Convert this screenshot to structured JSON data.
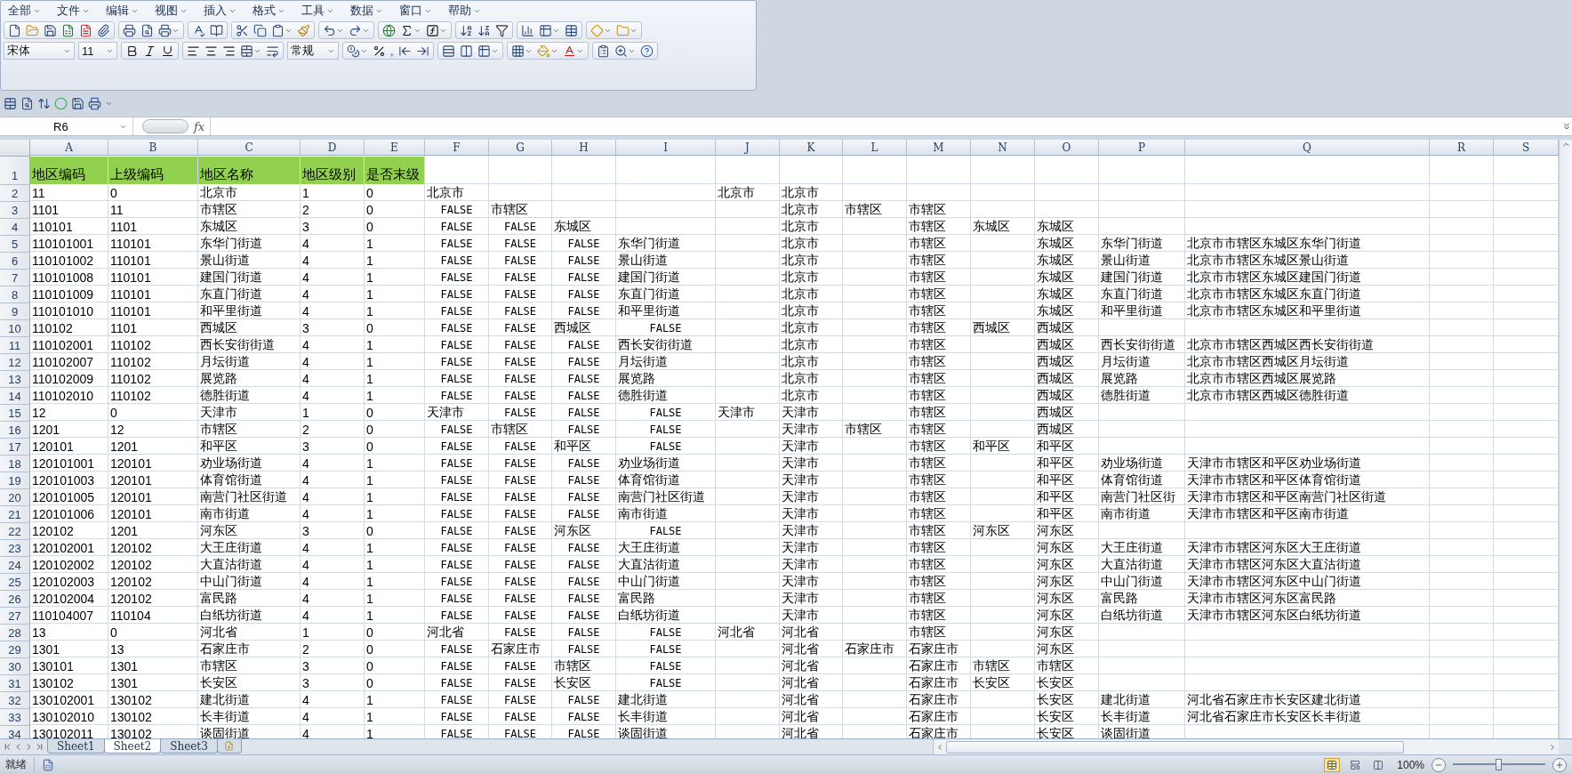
{
  "menu": [
    {
      "label": "全部"
    },
    {
      "label": "文件"
    },
    {
      "label": "编辑"
    },
    {
      "label": "视图"
    },
    {
      "label": "插入"
    },
    {
      "label": "格式"
    },
    {
      "label": "工具"
    },
    {
      "label": "数据"
    },
    {
      "label": "窗口"
    },
    {
      "label": "帮助"
    }
  ],
  "format_toolbar": {
    "font": "宋体",
    "font_size": "11",
    "number_format": "常规",
    "comma": ","
  },
  "formula_bar": {
    "name_box": "R6",
    "fx": "fx"
  },
  "columns": [
    "A",
    "B",
    "C",
    "D",
    "E",
    "F",
    "G",
    "H",
    "I",
    "J",
    "K",
    "L",
    "M",
    "N",
    "O",
    "P",
    "Q",
    "R",
    "S"
  ],
  "rows": [
    {
      "number": "1",
      "kind": "header",
      "cells": {
        "A": "地区编码",
        "B": "上级编码",
        "C": "地区名称",
        "D": "地区级别",
        "E": "是否末级"
      }
    },
    {
      "number": "2",
      "kind": "data",
      "cells": {
        "A": "11",
        "B": "0",
        "C": "北京市",
        "D": "1",
        "E": "0",
        "F": "北京市",
        "J": "北京市",
        "K": "北京市"
      }
    },
    {
      "number": "3",
      "kind": "data",
      "cells": {
        "A": "1101",
        "B": "11",
        "C": "市辖区",
        "D": "2",
        "E": "0",
        "F": {
          "text": "FALSE",
          "kind": "logical"
        },
        "G": "市辖区",
        "K": "北京市",
        "L": "市辖区",
        "M": "市辖区"
      }
    },
    {
      "number": "4",
      "kind": "data",
      "cells": {
        "A": "110101",
        "B": "1101",
        "C": "东城区",
        "D": "3",
        "E": "0",
        "F": {
          "text": "FALSE",
          "kind": "logical"
        },
        "G": {
          "text": "FALSE",
          "kind": "logical"
        },
        "H": "东城区",
        "K": "北京市",
        "M": "市辖区",
        "N": "东城区",
        "O": "东城区"
      }
    },
    {
      "number": "5",
      "kind": "data",
      "cells": {
        "A": "110101001",
        "B": "110101",
        "C": "东华门街道",
        "D": "4",
        "E": "1",
        "F": {
          "text": "FALSE",
          "kind": "logical"
        },
        "G": {
          "text": "FALSE",
          "kind": "logical"
        },
        "H": {
          "text": "FALSE",
          "kind": "logical"
        },
        "I": "东华门街道",
        "K": "北京市",
        "M": "市辖区",
        "O": "东城区",
        "P": "东华门街道",
        "Q": "北京市市辖区东城区东华门街道"
      }
    },
    {
      "number": "6",
      "kind": "data",
      "cells": {
        "A": "110101002",
        "B": "110101",
        "C": "景山街道",
        "D": "4",
        "E": "1",
        "F": {
          "text": "FALSE",
          "kind": "logical"
        },
        "G": {
          "text": "FALSE",
          "kind": "logical"
        },
        "H": {
          "text": "FALSE",
          "kind": "logical"
        },
        "I": "景山街道",
        "K": "北京市",
        "M": "市辖区",
        "O": "东城区",
        "P": "景山街道",
        "Q": "北京市市辖区东城区景山街道"
      }
    },
    {
      "number": "7",
      "kind": "data",
      "cells": {
        "A": "110101008",
        "B": "110101",
        "C": "建国门街道",
        "D": "4",
        "E": "1",
        "F": {
          "text": "FALSE",
          "kind": "logical"
        },
        "G": {
          "text": "FALSE",
          "kind": "logical"
        },
        "H": {
          "text": "FALSE",
          "kind": "logical"
        },
        "I": "建国门街道",
        "K": "北京市",
        "M": "市辖区",
        "O": "东城区",
        "P": "建国门街道",
        "Q": "北京市市辖区东城区建国门街道"
      }
    },
    {
      "number": "8",
      "kind": "data",
      "cells": {
        "A": "110101009",
        "B": "110101",
        "C": "东直门街道",
        "D": "4",
        "E": "1",
        "F": {
          "text": "FALSE",
          "kind": "logical"
        },
        "G": {
          "text": "FALSE",
          "kind": "logical"
        },
        "H": {
          "text": "FALSE",
          "kind": "logical"
        },
        "I": "东直门街道",
        "K": "北京市",
        "M": "市辖区",
        "O": "东城区",
        "P": "东直门街道",
        "Q": "北京市市辖区东城区东直门街道"
      }
    },
    {
      "number": "9",
      "kind": "data",
      "cells": {
        "A": "110101010",
        "B": "110101",
        "C": "和平里街道",
        "D": "4",
        "E": "1",
        "F": {
          "text": "FALSE",
          "kind": "logical"
        },
        "G": {
          "text": "FALSE",
          "kind": "logical"
        },
        "H": {
          "text": "FALSE",
          "kind": "logical"
        },
        "I": "和平里街道",
        "K": "北京市",
        "M": "市辖区",
        "O": "东城区",
        "P": "和平里街道",
        "Q": "北京市市辖区东城区和平里街道"
      }
    },
    {
      "number": "10",
      "kind": "data",
      "cells": {
        "A": "110102",
        "B": "1101",
        "C": "西城区",
        "D": "3",
        "E": "0",
        "F": {
          "text": "FALSE",
          "kind": "logical"
        },
        "G": {
          "text": "FALSE",
          "kind": "logical"
        },
        "H": "西城区",
        "I": {
          "text": "FALSE",
          "kind": "logical"
        },
        "K": "北京市",
        "M": "市辖区",
        "N": "西城区",
        "O": "西城区"
      }
    },
    {
      "number": "11",
      "kind": "data",
      "cells": {
        "A": "110102001",
        "B": "110102",
        "C": "西长安街街道",
        "D": "4",
        "E": "1",
        "F": {
          "text": "FALSE",
          "kind": "logical"
        },
        "G": {
          "text": "FALSE",
          "kind": "logical"
        },
        "H": {
          "text": "FALSE",
          "kind": "logical"
        },
        "I": "西长安街街道",
        "K": "北京市",
        "M": "市辖区",
        "O": "西城区",
        "P": "西长安街街道",
        "Q": "北京市市辖区西城区西长安街街道"
      }
    },
    {
      "number": "12",
      "kind": "data",
      "cells": {
        "A": "110102007",
        "B": "110102",
        "C": "月坛街道",
        "D": "4",
        "E": "1",
        "F": {
          "text": "FALSE",
          "kind": "logical"
        },
        "G": {
          "text": "FALSE",
          "kind": "logical"
        },
        "H": {
          "text": "FALSE",
          "kind": "logical"
        },
        "I": "月坛街道",
        "K": "北京市",
        "M": "市辖区",
        "O": "西城区",
        "P": "月坛街道",
        "Q": "北京市市辖区西城区月坛街道"
      }
    },
    {
      "number": "13",
      "kind": "data",
      "cells": {
        "A": "110102009",
        "B": "110102",
        "C": "展览路",
        "D": "4",
        "E": "1",
        "F": {
          "text": "FALSE",
          "kind": "logical"
        },
        "G": {
          "text": "FALSE",
          "kind": "logical"
        },
        "H": {
          "text": "FALSE",
          "kind": "logical"
        },
        "I": "展览路",
        "K": "北京市",
        "M": "市辖区",
        "O": "西城区",
        "P": "展览路",
        "Q": "北京市市辖区西城区展览路"
      }
    },
    {
      "number": "14",
      "kind": "data",
      "cells": {
        "A": "110102010",
        "B": "110102",
        "C": "德胜街道",
        "D": "4",
        "E": "1",
        "F": {
          "text": "FALSE",
          "kind": "logical"
        },
        "G": {
          "text": "FALSE",
          "kind": "logical"
        },
        "H": {
          "text": "FALSE",
          "kind": "logical"
        },
        "I": "德胜街道",
        "K": "北京市",
        "M": "市辖区",
        "O": "西城区",
        "P": "德胜街道",
        "Q": "北京市市辖区西城区德胜街道"
      }
    },
    {
      "number": "15",
      "kind": "data",
      "cells": {
        "A": "12",
        "B": "0",
        "C": "天津市",
        "D": "1",
        "E": "0",
        "F": "天津市",
        "G": {
          "text": "FALSE",
          "kind": "logical"
        },
        "H": {
          "text": "FALSE",
          "kind": "logical"
        },
        "I": {
          "text": "FALSE",
          "kind": "logical"
        },
        "J": "天津市",
        "K": "天津市",
        "M": "市辖区",
        "O": "西城区"
      }
    },
    {
      "number": "16",
      "kind": "data",
      "cells": {
        "A": "1201",
        "B": "12",
        "C": "市辖区",
        "D": "2",
        "E": "0",
        "F": {
          "text": "FALSE",
          "kind": "logical"
        },
        "G": "市辖区",
        "H": {
          "text": "FALSE",
          "kind": "logical"
        },
        "I": {
          "text": "FALSE",
          "kind": "logical"
        },
        "K": "天津市",
        "L": "市辖区",
        "M": "市辖区",
        "O": "西城区"
      }
    },
    {
      "number": "17",
      "kind": "data",
      "cells": {
        "A": "120101",
        "B": "1201",
        "C": "和平区",
        "D": "3",
        "E": "0",
        "F": {
          "text": "FALSE",
          "kind": "logical"
        },
        "G": {
          "text": "FALSE",
          "kind": "logical"
        },
        "H": "和平区",
        "I": {
          "text": "FALSE",
          "kind": "logical"
        },
        "K": "天津市",
        "M": "市辖区",
        "N": "和平区",
        "O": "和平区"
      }
    },
    {
      "number": "18",
      "kind": "data",
      "cells": {
        "A": "120101001",
        "B": "120101",
        "C": "劝业场街道",
        "D": "4",
        "E": "1",
        "F": {
          "text": "FALSE",
          "kind": "logical"
        },
        "G": {
          "text": "FALSE",
          "kind": "logical"
        },
        "H": {
          "text": "FALSE",
          "kind": "logical"
        },
        "I": "劝业场街道",
        "K": "天津市",
        "M": "市辖区",
        "O": "和平区",
        "P": "劝业场街道",
        "Q": "天津市市辖区和平区劝业场街道"
      }
    },
    {
      "number": "19",
      "kind": "data",
      "cells": {
        "A": "120101003",
        "B": "120101",
        "C": "体育馆街道",
        "D": "4",
        "E": "1",
        "F": {
          "text": "FALSE",
          "kind": "logical"
        },
        "G": {
          "text": "FALSE",
          "kind": "logical"
        },
        "H": {
          "text": "FALSE",
          "kind": "logical"
        },
        "I": "体育馆街道",
        "K": "天津市",
        "M": "市辖区",
        "O": "和平区",
        "P": "体育馆街道",
        "Q": "天津市市辖区和平区体育馆街道"
      }
    },
    {
      "number": "20",
      "kind": "data",
      "cells": {
        "A": "120101005",
        "B": "120101",
        "C": "南营门社区街道",
        "D": "4",
        "E": "1",
        "F": {
          "text": "FALSE",
          "kind": "logical"
        },
        "G": {
          "text": "FALSE",
          "kind": "logical"
        },
        "H": {
          "text": "FALSE",
          "kind": "logical"
        },
        "I": "南营门社区街道",
        "K": "天津市",
        "M": "市辖区",
        "O": "和平区",
        "P": "南营门社区街",
        "Q": "天津市市辖区和平区南营门社区街道"
      }
    },
    {
      "number": "21",
      "kind": "data",
      "cells": {
        "A": "120101006",
        "B": "120101",
        "C": "南市街道",
        "D": "4",
        "E": "1",
        "F": {
          "text": "FALSE",
          "kind": "logical"
        },
        "G": {
          "text": "FALSE",
          "kind": "logical"
        },
        "H": {
          "text": "FALSE",
          "kind": "logical"
        },
        "I": "南市街道",
        "K": "天津市",
        "M": "市辖区",
        "O": "和平区",
        "P": "南市街道",
        "Q": "天津市市辖区和平区南市街道"
      }
    },
    {
      "number": "22",
      "kind": "data",
      "cells": {
        "A": "120102",
        "B": "1201",
        "C": "河东区",
        "D": "3",
        "E": "0",
        "F": {
          "text": "FALSE",
          "kind": "logical"
        },
        "G": {
          "text": "FALSE",
          "kind": "logical"
        },
        "H": "河东区",
        "I": {
          "text": "FALSE",
          "kind": "logical"
        },
        "K": "天津市",
        "M": "市辖区",
        "N": "河东区",
        "O": "河东区"
      }
    },
    {
      "number": "23",
      "kind": "data",
      "cells": {
        "A": "120102001",
        "B": "120102",
        "C": "大王庄街道",
        "D": "4",
        "E": "1",
        "F": {
          "text": "FALSE",
          "kind": "logical"
        },
        "G": {
          "text": "FALSE",
          "kind": "logical"
        },
        "H": {
          "text": "FALSE",
          "kind": "logical"
        },
        "I": "大王庄街道",
        "K": "天津市",
        "M": "市辖区",
        "O": "河东区",
        "P": "大王庄街道",
        "Q": "天津市市辖区河东区大王庄街道"
      }
    },
    {
      "number": "24",
      "kind": "data",
      "cells": {
        "A": "120102002",
        "B": "120102",
        "C": "大直沽街道",
        "D": "4",
        "E": "1",
        "F": {
          "text": "FALSE",
          "kind": "logical"
        },
        "G": {
          "text": "FALSE",
          "kind": "logical"
        },
        "H": {
          "text": "FALSE",
          "kind": "logical"
        },
        "I": "大直沽街道",
        "K": "天津市",
        "M": "市辖区",
        "O": "河东区",
        "P": "大直沽街道",
        "Q": "天津市市辖区河东区大直沽街道"
      }
    },
    {
      "number": "25",
      "kind": "data",
      "cells": {
        "A": "120102003",
        "B": "120102",
        "C": "中山门街道",
        "D": "4",
        "E": "1",
        "F": {
          "text": "FALSE",
          "kind": "logical"
        },
        "G": {
          "text": "FALSE",
          "kind": "logical"
        },
        "H": {
          "text": "FALSE",
          "kind": "logical"
        },
        "I": "中山门街道",
        "K": "天津市",
        "M": "市辖区",
        "O": "河东区",
        "P": "中山门街道",
        "Q": "天津市市辖区河东区中山门街道"
      }
    },
    {
      "number": "26",
      "kind": "data",
      "cells": {
        "A": "120102004",
        "B": "120102",
        "C": "富民路",
        "D": "4",
        "E": "1",
        "F": {
          "text": "FALSE",
          "kind": "logical"
        },
        "G": {
          "text": "FALSE",
          "kind": "logical"
        },
        "H": {
          "text": "FALSE",
          "kind": "logical"
        },
        "I": "富民路",
        "K": "天津市",
        "M": "市辖区",
        "O": "河东区",
        "P": "富民路",
        "Q": "天津市市辖区河东区富民路"
      }
    },
    {
      "number": "27",
      "kind": "data",
      "cells": {
        "A": "110104007",
        "B": "110104",
        "C": "白纸坊街道",
        "D": "4",
        "E": "1",
        "F": {
          "text": "FALSE",
          "kind": "logical"
        },
        "G": {
          "text": "FALSE",
          "kind": "logical"
        },
        "H": {
          "text": "FALSE",
          "kind": "logical"
        },
        "I": "白纸坊街道",
        "K": "天津市",
        "M": "市辖区",
        "O": "河东区",
        "P": "白纸坊街道",
        "Q": "天津市市辖区河东区白纸坊街道"
      }
    },
    {
      "number": "28",
      "kind": "data",
      "cells": {
        "A": "13",
        "B": "0",
        "C": "河北省",
        "D": "1",
        "E": "0",
        "F": "河北省",
        "G": {
          "text": "FALSE",
          "kind": "logical"
        },
        "H": {
          "text": "FALSE",
          "kind": "logical"
        },
        "I": {
          "text": "FALSE",
          "kind": "logical"
        },
        "J": "河北省",
        "K": "河北省",
        "M": "市辖区",
        "O": "河东区"
      }
    },
    {
      "number": "29",
      "kind": "data",
      "cells": {
        "A": "1301",
        "B": "13",
        "C": "石家庄市",
        "D": "2",
        "E": "0",
        "F": {
          "text": "FALSE",
          "kind": "logical"
        },
        "G": "石家庄市",
        "H": {
          "text": "FALSE",
          "kind": "logical"
        },
        "I": {
          "text": "FALSE",
          "kind": "logical"
        },
        "K": "河北省",
        "L": "石家庄市",
        "M": "石家庄市",
        "O": "河东区"
      }
    },
    {
      "number": "30",
      "kind": "data",
      "cells": {
        "A": "130101",
        "B": "1301",
        "C": "市辖区",
        "D": "3",
        "E": "0",
        "F": {
          "text": "FALSE",
          "kind": "logical"
        },
        "G": {
          "text": "FALSE",
          "kind": "logical"
        },
        "H": "市辖区",
        "I": {
          "text": "FALSE",
          "kind": "logical"
        },
        "K": "河北省",
        "M": "石家庄市",
        "N": "市辖区",
        "O": "市辖区"
      }
    },
    {
      "number": "31",
      "kind": "data",
      "cells": {
        "A": "130102",
        "B": "1301",
        "C": "长安区",
        "D": "3",
        "E": "0",
        "F": {
          "text": "FALSE",
          "kind": "logical"
        },
        "G": {
          "text": "FALSE",
          "kind": "logical"
        },
        "H": "长安区",
        "I": {
          "text": "FALSE",
          "kind": "logical"
        },
        "K": "河北省",
        "M": "石家庄市",
        "N": "长安区",
        "O": "长安区"
      }
    },
    {
      "number": "32",
      "kind": "data",
      "cells": {
        "A": "130102001",
        "B": "130102",
        "C": "建北街道",
        "D": "4",
        "E": "1",
        "F": {
          "text": "FALSE",
          "kind": "logical"
        },
        "G": {
          "text": "FALSE",
          "kind": "logical"
        },
        "H": {
          "text": "FALSE",
          "kind": "logical"
        },
        "I": "建北街道",
        "K": "河北省",
        "M": "石家庄市",
        "O": "长安区",
        "P": "建北街道",
        "Q": "河北省石家庄市长安区建北街道"
      }
    },
    {
      "number": "33",
      "kind": "data",
      "cells": {
        "A": "130102010",
        "B": "130102",
        "C": "长丰街道",
        "D": "4",
        "E": "1",
        "F": {
          "text": "FALSE",
          "kind": "logical"
        },
        "G": {
          "text": "FALSE",
          "kind": "logical"
        },
        "H": {
          "text": "FALSE",
          "kind": "logical"
        },
        "I": "长丰街道",
        "K": "河北省",
        "M": "石家庄市",
        "O": "长安区",
        "P": "长丰街道",
        "Q": "河北省石家庄市长安区长丰街道"
      }
    },
    {
      "number": "34",
      "kind": "data",
      "cells": {
        "A": "130102011",
        "B": "130102",
        "C": "谈固街道",
        "D": "4",
        "E": "1",
        "F": {
          "text": "FALSE",
          "kind": "logical"
        },
        "G": {
          "text": "FALSE",
          "kind": "logical"
        },
        "H": {
          "text": "FALSE",
          "kind": "logical"
        },
        "I": "谈固街道",
        "K": "河北省",
        "M": "石家庄市",
        "O": "长安区",
        "P": "谈固街道"
      }
    }
  ],
  "sheet_tabs": [
    {
      "label": "Sheet1",
      "selected": false
    },
    {
      "label": "Sheet2",
      "selected": true
    },
    {
      "label": "Sheet3",
      "selected": false
    }
  ],
  "status_bar": {
    "status": "就绪",
    "view_buttons": [
      {
        "selected": true
      },
      {
        "selected": false
      },
      {
        "selected": false
      }
    ],
    "zoom": "100%",
    "zoom_slider": {
      "level": 0.5
    }
  }
}
